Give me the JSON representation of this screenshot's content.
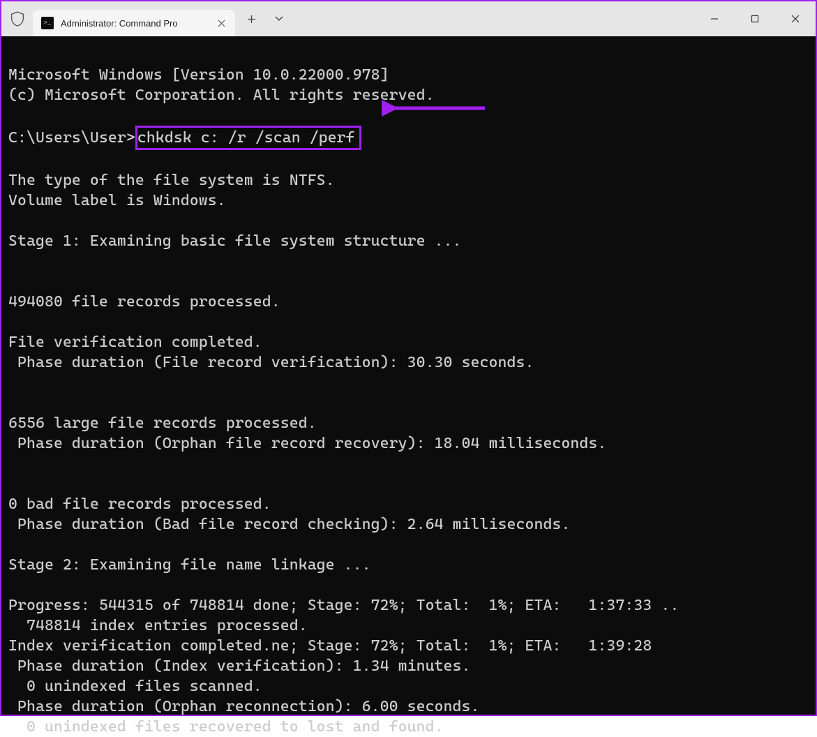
{
  "window": {
    "tab_title": "Administrator: Command Pro",
    "tab_favicon_glyph": ">_"
  },
  "annotation": {
    "highlight_color": "#a020f0"
  },
  "terminal": {
    "header_lines": [
      "Microsoft Windows [Version 10.0.22000.978]",
      "(c) Microsoft Corporation. All rights reserved."
    ],
    "prompt": "C:\\Users\\User>",
    "command": "chkdsk c: /r /scan /perf",
    "output_lines": [
      "The type of the file system is NTFS.",
      "Volume label is Windows.",
      "",
      "Stage 1: Examining basic file system structure ...",
      "",
      "",
      "494080 file records processed.",
      "",
      "File verification completed.",
      " Phase duration (File record verification): 30.30 seconds.",
      "",
      "",
      "6556 large file records processed.",
      " Phase duration (Orphan file record recovery): 18.04 milliseconds.",
      "",
      "",
      "0 bad file records processed.",
      " Phase duration (Bad file record checking): 2.64 milliseconds.",
      "",
      "Stage 2: Examining file name linkage ...",
      "",
      "Progress: 544315 of 748814 done; Stage: 72%; Total:  1%; ETA:   1:37:33 ..",
      "  748814 index entries processed.",
      "Index verification completed.ne; Stage: 72%; Total:  1%; ETA:   1:39:28",
      " Phase duration (Index verification): 1.34 minutes.",
      "  0 unindexed files scanned.",
      " Phase duration (Orphan reconnection): 6.00 seconds.",
      "  0 unindexed files recovered to lost and found."
    ]
  }
}
